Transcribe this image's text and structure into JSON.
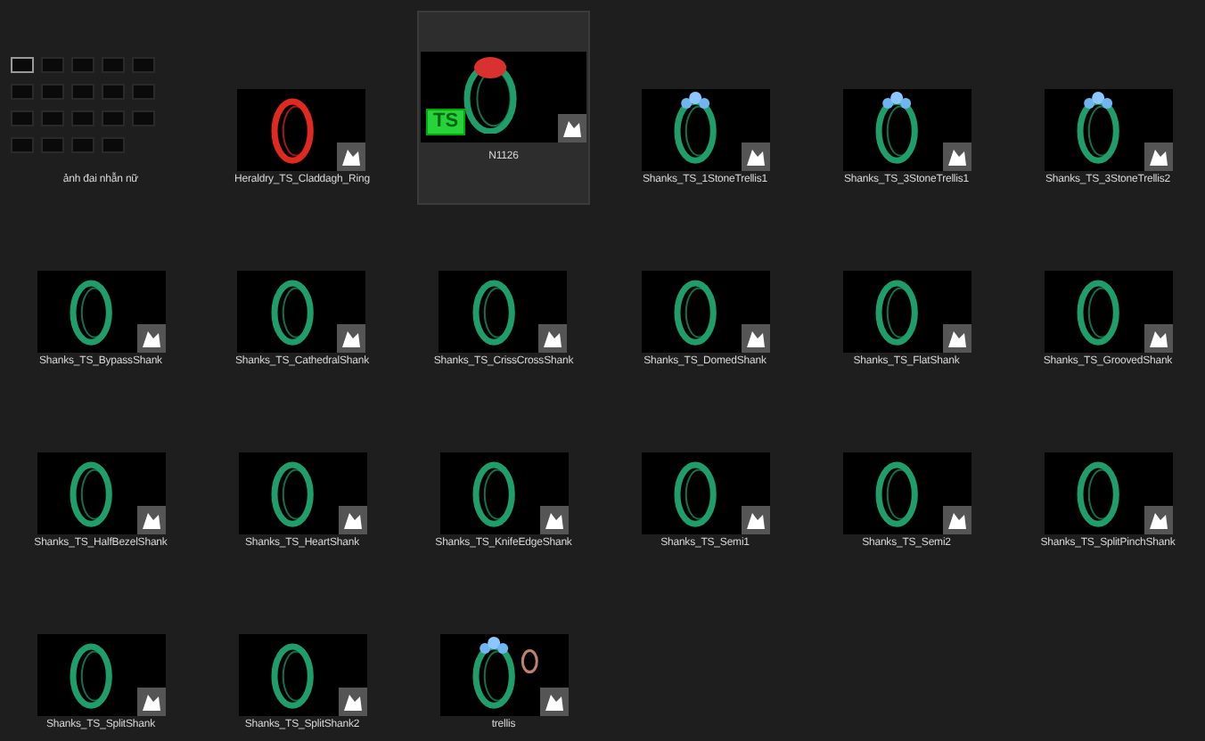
{
  "items": [
    {
      "kind": "folder",
      "label": "ảnh đai nhẫn nữ",
      "selected": false
    },
    {
      "kind": "shank",
      "label": "Heraldry_TS_Claddagh_Ring",
      "selected": false,
      "color": "#e02a20"
    },
    {
      "kind": "stone",
      "label": "N1126",
      "selected": true,
      "color": "#1f9e6a",
      "badge": "TS"
    },
    {
      "kind": "gems",
      "label": "Shanks_TS_1StoneTrellis1",
      "selected": false,
      "color": "#1f9e6a"
    },
    {
      "kind": "gems",
      "label": "Shanks_TS_3StoneTrellis1",
      "selected": false,
      "color": "#1f9e6a"
    },
    {
      "kind": "gems",
      "label": "Shanks_TS_3StoneTrellis2",
      "selected": false,
      "color": "#1f9e6a"
    },
    {
      "kind": "shank",
      "label": "Shanks_TS_BypassShank",
      "selected": false,
      "color": "#1f9e6a"
    },
    {
      "kind": "shank",
      "label": "Shanks_TS_CathedralShank",
      "selected": false,
      "color": "#1f9e6a"
    },
    {
      "kind": "shank",
      "label": "Shanks_TS_CrissCrossShank",
      "selected": false,
      "color": "#1f9e6a"
    },
    {
      "kind": "shank",
      "label": "Shanks_TS_DomedShank",
      "selected": false,
      "color": "#1f9e6a"
    },
    {
      "kind": "shank",
      "label": "Shanks_TS_FlatShank",
      "selected": false,
      "color": "#1f9e6a"
    },
    {
      "kind": "shank",
      "label": "Shanks_TS_GroovedShank",
      "selected": false,
      "color": "#1f9e6a"
    },
    {
      "kind": "shank",
      "label": "Shanks_TS_HalfBezelShank",
      "selected": false,
      "color": "#1f9e6a"
    },
    {
      "kind": "shank",
      "label": "Shanks_TS_HeartShank",
      "selected": false,
      "color": "#1f9e6a"
    },
    {
      "kind": "shank",
      "label": "Shanks_TS_KnifeEdgeShank",
      "selected": false,
      "color": "#1f9e6a"
    },
    {
      "kind": "shank",
      "label": "Shanks_TS_Semi1",
      "selected": false,
      "color": "#1f9e6a"
    },
    {
      "kind": "shank",
      "label": "Shanks_TS_Semi2",
      "selected": false,
      "color": "#1f9e6a"
    },
    {
      "kind": "shank",
      "label": "Shanks_TS_SplitPinchShank",
      "selected": false,
      "color": "#1f9e6a"
    },
    {
      "kind": "shank",
      "label": "Shanks_TS_SplitShank",
      "selected": false,
      "color": "#1f9e6a"
    },
    {
      "kind": "shank",
      "label": "Shanks_TS_SplitShank2",
      "selected": false,
      "color": "#1f9e6a"
    },
    {
      "kind": "set",
      "label": "trellis",
      "selected": false,
      "color": "#1f9e6a"
    }
  ]
}
